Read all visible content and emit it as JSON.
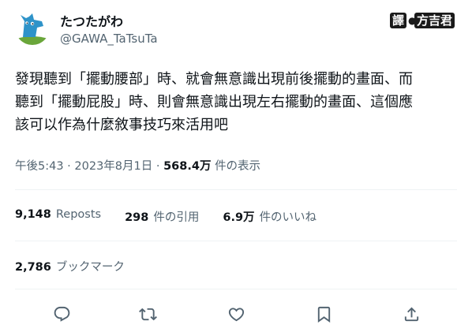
{
  "author": {
    "display_name": "たつたがわ",
    "handle": "@GAWA_TaTsuTa",
    "avatar_icon": "blue-dog-avatar-icon"
  },
  "translator_badge": {
    "label_1": "譯",
    "label_2": "方吉君"
  },
  "tweet": {
    "lines": [
      "發現聽到「擺動腰部」時、就會無意識出現前後擺動的畫面、而",
      "聽到「擺動屁股」時、則會無意識出現左右擺動的畫面、這個應",
      "該可以作為什麼敘事技巧來活用吧"
    ]
  },
  "meta": {
    "time": "午後5:43",
    "separator": "·",
    "date": "2023年8月1日",
    "views_count": "568.4万",
    "views_label": "件の表示"
  },
  "stats": {
    "reposts_count": "9,148",
    "reposts_label": "Reposts",
    "quotes_count": "298",
    "quotes_label": "件の引用",
    "likes_count": "6.9万",
    "likes_label": "件のいいね"
  },
  "bookmarks": {
    "count": "2,786",
    "label": "ブックマーク"
  },
  "colors": {
    "text_primary": "#0f1419",
    "text_secondary": "#536471",
    "divider": "#eff3f4",
    "avatar_blue": "#2e93c9",
    "avatar_green": "#6aa63a"
  }
}
